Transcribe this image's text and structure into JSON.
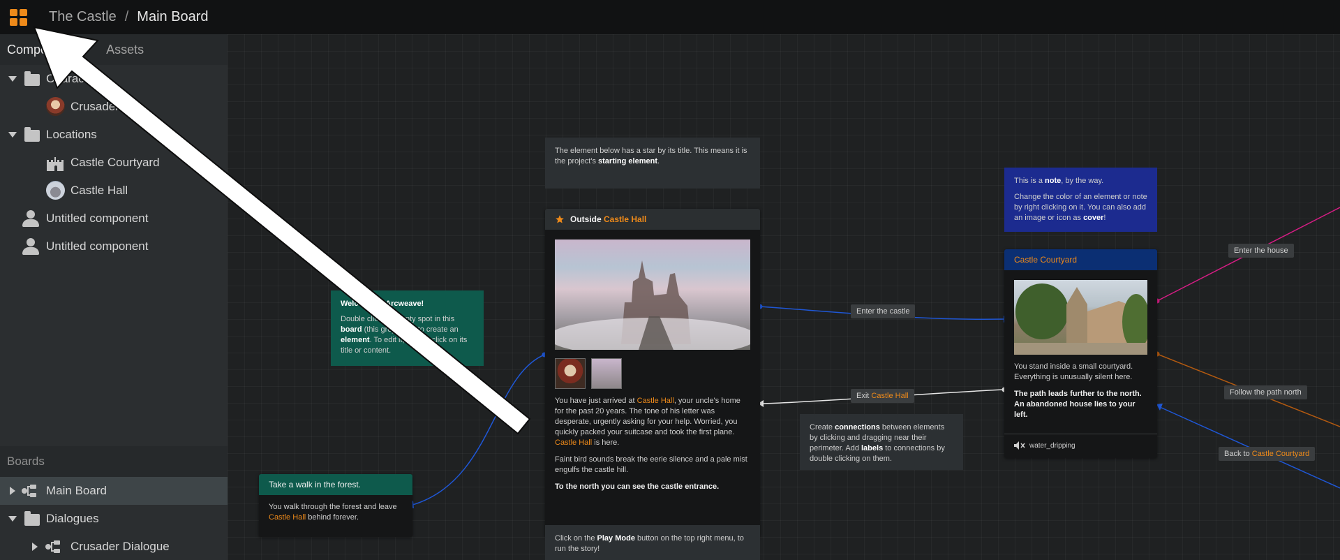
{
  "header": {
    "project": "The Castle",
    "separator": "/",
    "board": "Main Board"
  },
  "sidebar": {
    "tabs": [
      "Components",
      "Assets"
    ],
    "components": {
      "characters_folder": "Characters",
      "crusader": "Crusader",
      "locations_folder": "Locations",
      "castle_courtyard": "Castle Courtyard",
      "castle_hall": "Castle Hall",
      "untitled_1": "Untitled component",
      "untitled_2": "Untitled component"
    },
    "boards": {
      "header": "Boards",
      "main_board": "Main Board",
      "dialogues_folder": "Dialogues",
      "crusader_dialogue": "Crusader Dialogue"
    }
  },
  "canvas": {
    "note_star": {
      "line1": "The element below has a star by its title. This means it is the project's",
      "bold": "starting element",
      "end": "."
    },
    "note_welcome": {
      "title_a": "Welcome to ",
      "title_b": "Arcweave!",
      "t1": "Double click an empty spot in this ",
      "b1": "board",
      "t2": " (this grey area) to create an ",
      "b2": "element",
      "t3": ". To edit it, double click on its title or content."
    },
    "note_blue": {
      "p1a": "This is a ",
      "p1b": "note",
      "p1c": ", by the way.",
      "p2a": "Change the color of an element or note by right clicking on it. You can also add an image or icon as ",
      "p2b": "cover",
      "p2c": "!"
    },
    "note_connections": {
      "t1": "Create ",
      "b1": "connections",
      "t2": " between elements by clicking and dragging near their perimeter. Add ",
      "b2": "labels",
      "t3": " to connections by double clicking on them."
    },
    "note_play": {
      "t1": "Click on the ",
      "b1": "Play Mode",
      "t2": " button on the top right menu, to run the story!"
    },
    "outside": {
      "title_a": "Outside ",
      "title_b": "Castle Hall",
      "p1a": "You have just arrived at ",
      "p1b": "Castle Hall",
      "p1c": ", your uncle's home for the past 20 years. The tone of his letter was desperate, urgently asking for your help. Worried, you quickly packed your suitcase and took the first plane. ",
      "p1d": "Castle Hall",
      "p1e": " is here.",
      "p2": "Faint bird sounds break the eerie silence and a pale mist engulfs the castle hill.",
      "p3": "To the north you can see the castle entrance."
    },
    "forest": {
      "title": "Take a walk in the forest.",
      "t1": "You walk through the forest and leave ",
      "o1": "Castle Hall",
      "t2": " behind forever."
    },
    "courtyard": {
      "title": "Castle Courtyard",
      "p1": "You stand inside a small courtyard. Everything is unusually silent here.",
      "p2": "The path leads further to the north. An abandoned house lies to your left.",
      "audio": "water_dripping"
    },
    "labels": {
      "enter_castle": "Enter the castle",
      "exit_a": "Exit ",
      "exit_b": "Castle Hall",
      "enter_house": "Enter the house",
      "follow_path": "Follow the path north",
      "back_a": "Back to ",
      "back_b": "Castle Courtyard"
    }
  },
  "colors": {
    "accent": "#ee8a1a",
    "teal": "#0e5a4c",
    "blue_note": "#1c2b8f",
    "courtyard_header": "#0b2f73",
    "wire_blue": "#1f57d6",
    "wire_pink": "#d51d84",
    "wire_orange": "#b35a10"
  }
}
